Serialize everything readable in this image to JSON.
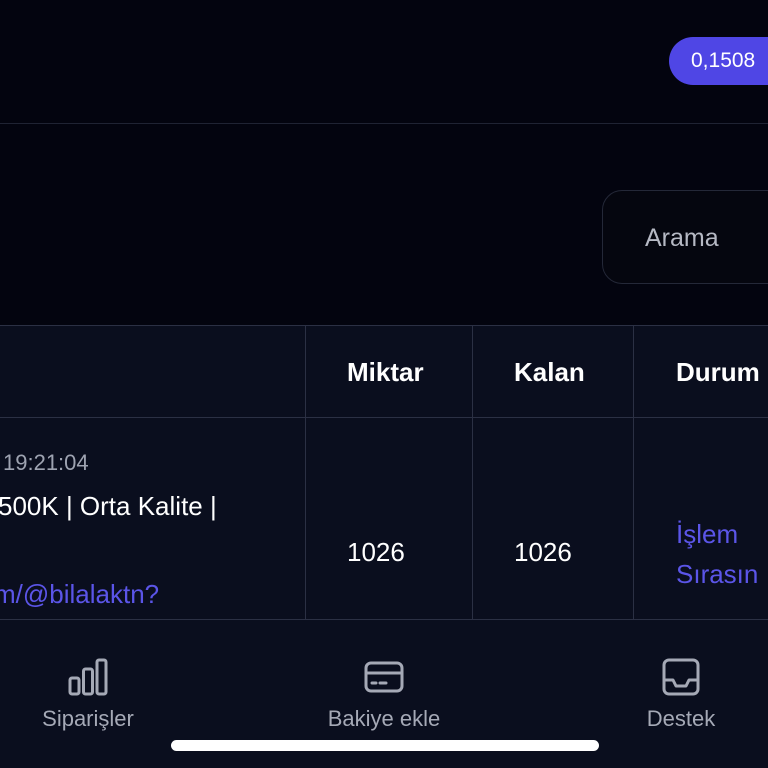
{
  "header": {
    "balance": "0,1508"
  },
  "search": {
    "placeholder": "Arama"
  },
  "table": {
    "columns": {
      "amount": "Miktar",
      "remaining": "Kalan",
      "status": "Durum"
    },
    "rows": [
      {
        "time": "19:21:04",
        "service": "500K | Orta Kalite |",
        "link": "m/@bilalaktn?",
        "amount": "1026",
        "remaining": "1026",
        "status_line1": "İşlem",
        "status_line2": "Sırasın"
      }
    ]
  },
  "nav": {
    "orders": "Siparişler",
    "add_balance": "Bakiye ekle",
    "support": "Destek"
  },
  "colors": {
    "accent": "#4f46e5",
    "link": "#5b55e8",
    "background": "#03040f",
    "panel": "#0a0e1e"
  }
}
